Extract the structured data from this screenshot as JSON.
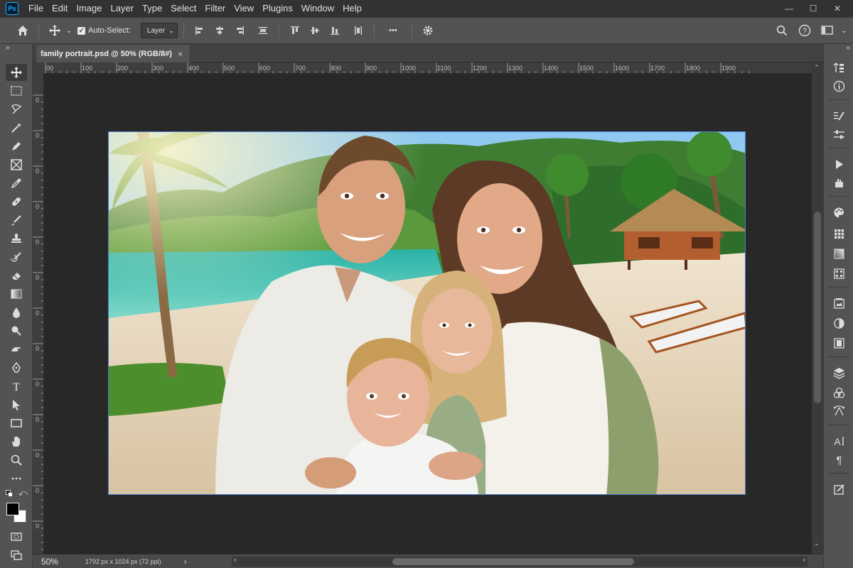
{
  "app": {
    "logo_text": "Ps"
  },
  "menu": [
    "File",
    "Edit",
    "Image",
    "Layer",
    "Type",
    "Select",
    "Filter",
    "View",
    "Plugins",
    "Window",
    "Help"
  ],
  "window_controls": {
    "minimize": "—",
    "maximize": "☐",
    "close": "✕"
  },
  "options": {
    "autoselect_label": "Auto-Select:",
    "autoselect_checked": true,
    "layer_select_value": "Layer",
    "more_label": "•••"
  },
  "document": {
    "tab_title": "family portrait.psd @ 50% (RGB/8#)",
    "close_glyph": "×",
    "zoom": "50%",
    "info": "1792 px x 1024 px (72 ppi)"
  },
  "ruler": {
    "h_labels": [
      "00",
      "100",
      "200",
      "300",
      "400",
      "500",
      "600",
      "700",
      "800",
      "900",
      "1000",
      "1100",
      "1200",
      "1300",
      "1400",
      "1500",
      "1600",
      "1700",
      "1800",
      "1900"
    ],
    "v_labels": [
      "0",
      "0",
      "0",
      "0",
      "0",
      "0",
      "0",
      "0",
      "0",
      "0",
      "0",
      "0",
      "0",
      "0"
    ]
  },
  "colors": {
    "ui_dark": "#323232",
    "ui_mid": "#535353",
    "canvas_bg": "#282828",
    "selection_border": "#4a7fd0",
    "ps_blue": "#31a8ff"
  },
  "toolbar_icons": [
    "move-icon",
    "marquee-icon",
    "lasso-icon",
    "magic-wand-icon",
    "brush-pen-icon",
    "crop-icon",
    "eyedropper-icon",
    "healing-icon",
    "brush-icon",
    "stamp-icon",
    "history-brush-icon",
    "eraser-icon",
    "gradient-icon",
    "blur-icon",
    "dodge-icon",
    "smudge-icon",
    "pen-icon",
    "type-icon",
    "path-select-icon",
    "rectangle-icon",
    "hand-icon",
    "zoom-icon",
    "more-tools-icon"
  ],
  "right_panel_icons": [
    "history-icon",
    "info-icon",
    "brush-settings-icon",
    "adjust-icon",
    "play-icon",
    "toolpresets-icon",
    "palette-icon",
    "swatches-grid-icon",
    "gradient-panel-icon",
    "patterns-icon",
    "libraries-icon",
    "adjustments-icon",
    "properties-icon",
    "layers-icon",
    "channels-icon",
    "paths-icon",
    "character-icon",
    "paragraph-icon",
    "notes-icon"
  ]
}
